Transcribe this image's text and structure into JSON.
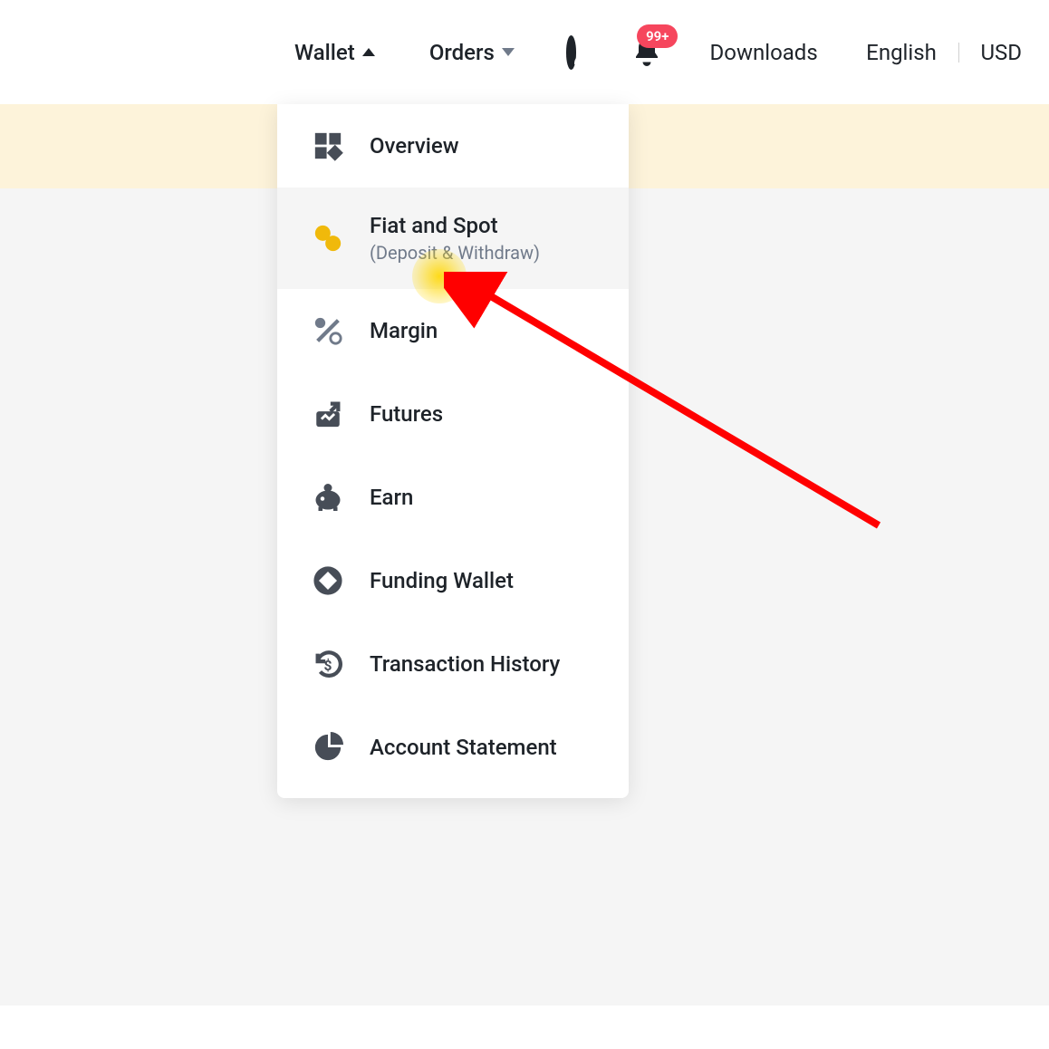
{
  "header": {
    "wallet_label": "Wallet",
    "orders_label": "Orders",
    "downloads_label": "Downloads",
    "language_label": "English",
    "currency_label": "USD",
    "notification_badge": "99+"
  },
  "wallet_menu": {
    "items": [
      {
        "label": "Overview",
        "icon": "grid-icon"
      },
      {
        "label": "Fiat and Spot",
        "sublabel": "(Deposit & Withdraw)",
        "icon": "exchange-icon",
        "highlighted": true
      },
      {
        "label": "Margin",
        "icon": "percent-icon"
      },
      {
        "label": "Futures",
        "icon": "chart-up-icon"
      },
      {
        "label": "Earn",
        "icon": "piggy-bank-icon"
      },
      {
        "label": "Funding Wallet",
        "icon": "diamond-circle-icon"
      },
      {
        "label": "Transaction History",
        "icon": "clock-dollar-icon"
      },
      {
        "label": "Account Statement",
        "icon": "pie-icon"
      }
    ]
  },
  "annotation": {
    "arrow_color": "#ff0000"
  }
}
